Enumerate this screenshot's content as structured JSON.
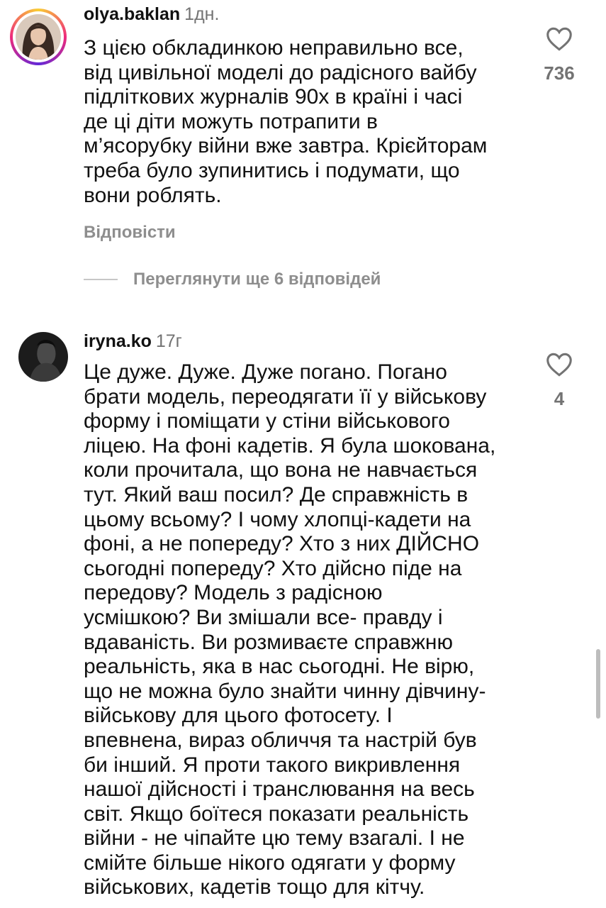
{
  "comments": [
    {
      "username": "olya.baklan",
      "time": "1дн.",
      "text": "З цією обкладинкою неправильно все,\nвід цивільної моделі до радісного вайбу\nпідліткових журналів 90х в країні і часі\nде ці діти можуть потрапити в\nм’ясорубку війни вже завтра. Крієйторам\nтреба було зупинитись і подумати, що\nвони роблять.",
      "likes": "736",
      "reply_label": "Відповісти",
      "view_replies_label": "Переглянути ще 6 відповідей"
    },
    {
      "username": "iryna.ko",
      "time": "17г",
      "text": "Це дуже. Дуже. Дуже погано. Погано\nбрати модель, переодягати її у військову\nформу і поміщати у стіни військового\nліцею. На фоні кадетів. Я була шокована,\nколи прочитала, що вона не навчається\nтут. Який ваш посил? Де справжність в\nцьому всьому? І чому хлопці-кадети на\nфоні, а не попереду? Хто з них ДІЙСНО\nсьогодні попереду? Хто дійсно піде на\nпередову? Модель з радісною\nусмішкою? Ви змішали все- правду і\nвдаваність. Ви розмиваєте справжню\nреальність, яка в нас сьогодні. Не вірю,\nщо не можна було знайти чинну дівчину-\nвійськову для цього фотосету. І\nвпевнена, вираз обличчя та настрій був\nби інший. Я проти такого викривлення\nнашої дійсності і транслювання на весь\nсвіт. Якщо боїтеся показати реальність\nвійни -  не чіпайте цю тему взагалі. І не\nсмійте більше нікого одягати у форму\nвійськових, кадетів тощо для кітчу.",
      "likes": "4"
    }
  ],
  "icons": {
    "like": "heart-outline-icon"
  },
  "colors": {
    "text": "#111111",
    "muted": "#737373",
    "ring_start": "#f9ce34",
    "ring_mid": "#ee2a7b",
    "ring_end": "#6228d7"
  }
}
